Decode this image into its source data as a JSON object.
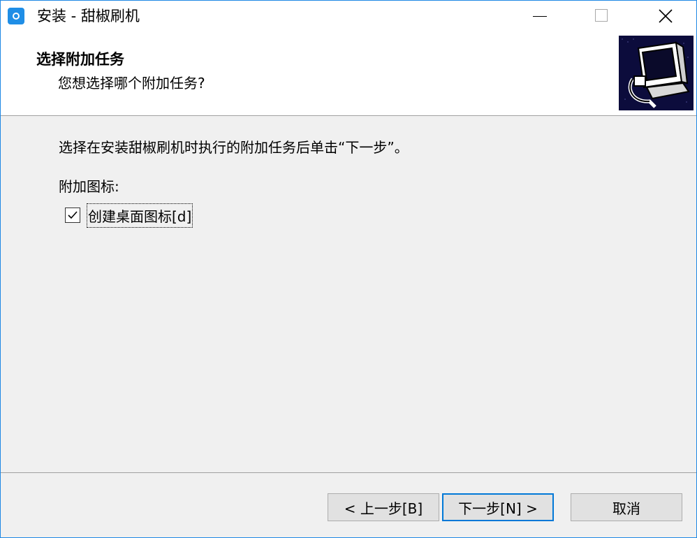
{
  "window": {
    "title": "安装 - 甜椒刷机"
  },
  "header": {
    "title": "选择附加任务",
    "subtitle": "您想选择哪个附加任务?"
  },
  "body": {
    "instruction": "选择在安装甜椒刷机时执行的附加任务后单击“下一步”。",
    "group_label": "附加图标:",
    "tasks": [
      {
        "label": "创建桌面图标[d]",
        "checked": true
      }
    ]
  },
  "buttons": {
    "back": "< 上一步[B]",
    "next": "下一步[N] >",
    "cancel": "取消"
  },
  "colors": {
    "accent": "#0078d7",
    "app_icon": "#1f8ee6",
    "wizard_image_bg": "#0c0c3c"
  },
  "icons": {
    "app": "app-icon",
    "minimize": "minimize-icon",
    "maximize": "maximize-icon",
    "close": "close-icon",
    "wizard": "computer-install-icon",
    "check": "checkmark-icon"
  }
}
